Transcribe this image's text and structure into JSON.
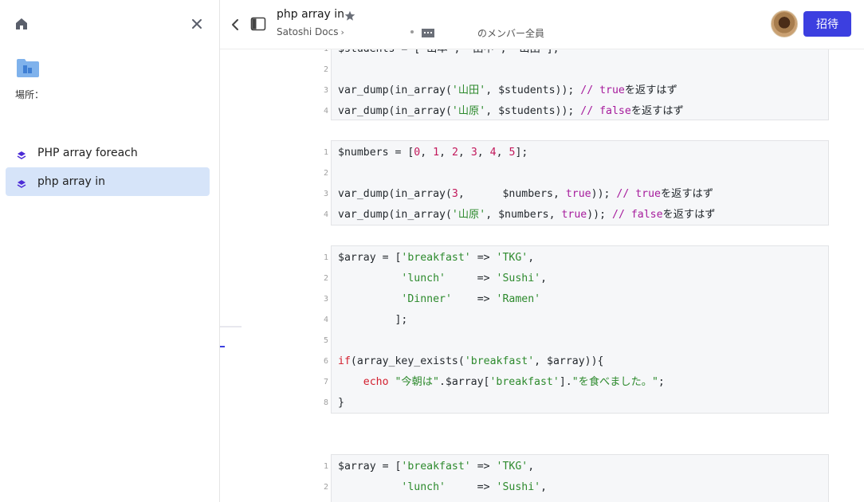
{
  "sidebar": {
    "location_label": "場所：",
    "items": [
      {
        "label": "PHP array foreach",
        "active": false
      },
      {
        "label": "php array in",
        "active": true
      }
    ]
  },
  "header": {
    "title": "php array in",
    "breadcrumb_workspace": "Satoshi Docs",
    "breadcrumb_chevron": "›",
    "members_label": "のメンバー全員",
    "invite_label": "招待"
  },
  "colors": {
    "accent": "#3c3fe0",
    "active_item_bg": "#d6e4f9",
    "string": "#2d8a2d",
    "number": "#c2185b",
    "keyword": "#d3202f"
  },
  "code_blocks": [
    {
      "lines": [
        {
          "n": "1",
          "tokens": [
            [
              "plain",
              "$students = ['山本', '田中', '山田'];"
            ]
          ]
        },
        {
          "n": "2",
          "tokens": []
        },
        {
          "n": "3",
          "tokens": [
            [
              "plain",
              "var_dump(in_array("
            ],
            [
              "str",
              "'山田'"
            ],
            [
              "plain",
              ", $students)); "
            ],
            [
              "com",
              "// "
            ],
            [
              "bool",
              "true"
            ],
            [
              "plain",
              "を返すはず"
            ]
          ]
        },
        {
          "n": "4",
          "tokens": [
            [
              "plain",
              "var_dump(in_array("
            ],
            [
              "str",
              "'山原'"
            ],
            [
              "plain",
              ", $students)); "
            ],
            [
              "com",
              "// "
            ],
            [
              "bool",
              "false"
            ],
            [
              "plain",
              "を返すはず"
            ]
          ]
        }
      ]
    },
    {
      "lines": [
        {
          "n": "1",
          "tokens": [
            [
              "plain",
              "$numbers = ["
            ],
            [
              "num",
              "0"
            ],
            [
              "plain",
              ", "
            ],
            [
              "num",
              "1"
            ],
            [
              "plain",
              ", "
            ],
            [
              "num",
              "2"
            ],
            [
              "plain",
              ", "
            ],
            [
              "num",
              "3"
            ],
            [
              "plain",
              ", "
            ],
            [
              "num",
              "4"
            ],
            [
              "plain",
              ", "
            ],
            [
              "num",
              "5"
            ],
            [
              "plain",
              "];"
            ]
          ]
        },
        {
          "n": "2",
          "tokens": []
        },
        {
          "n": "3",
          "tokens": [
            [
              "plain",
              "var_dump(in_array("
            ],
            [
              "num",
              "3"
            ],
            [
              "plain",
              ",      $numbers, "
            ],
            [
              "bool",
              "true"
            ],
            [
              "plain",
              ")); "
            ],
            [
              "com",
              "// "
            ],
            [
              "bool",
              "true"
            ],
            [
              "plain",
              "を返すはず"
            ]
          ]
        },
        {
          "n": "4",
          "tokens": [
            [
              "plain",
              "var_dump(in_array("
            ],
            [
              "str",
              "'山原'"
            ],
            [
              "plain",
              ", $numbers, "
            ],
            [
              "bool",
              "true"
            ],
            [
              "plain",
              ")); "
            ],
            [
              "com",
              "// "
            ],
            [
              "bool",
              "false"
            ],
            [
              "plain",
              "を返すはず"
            ]
          ]
        }
      ]
    },
    {
      "lines": [
        {
          "n": "1",
          "tokens": [
            [
              "plain",
              "$array = ["
            ],
            [
              "str",
              "'breakfast'"
            ],
            [
              "plain",
              " => "
            ],
            [
              "str",
              "'TKG'"
            ],
            [
              "plain",
              ","
            ]
          ]
        },
        {
          "n": "2",
          "tokens": [
            [
              "plain",
              "          "
            ],
            [
              "str",
              "'lunch'"
            ],
            [
              "plain",
              "     => "
            ],
            [
              "str",
              "'Sushi'"
            ],
            [
              "plain",
              ","
            ]
          ]
        },
        {
          "n": "3",
          "tokens": [
            [
              "plain",
              "          "
            ],
            [
              "str",
              "'Dinner'"
            ],
            [
              "plain",
              "    => "
            ],
            [
              "str",
              "'Ramen'"
            ]
          ]
        },
        {
          "n": "4",
          "tokens": [
            [
              "plain",
              "         ];"
            ]
          ]
        },
        {
          "n": "5",
          "tokens": []
        },
        {
          "n": "6",
          "tokens": [
            [
              "kw",
              "if"
            ],
            [
              "plain",
              "(array_key_exists("
            ],
            [
              "str",
              "'breakfast'"
            ],
            [
              "plain",
              ", $array)){"
            ]
          ]
        },
        {
          "n": "7",
          "tokens": [
            [
              "plain",
              "    "
            ],
            [
              "kw",
              "echo"
            ],
            [
              "plain",
              " "
            ],
            [
              "str",
              "\"今朝は\""
            ],
            [
              "plain",
              ".$array["
            ],
            [
              "str",
              "'breakfast'"
            ],
            [
              "plain",
              "]."
            ],
            [
              "str",
              "\"を食べました。\""
            ],
            [
              "plain",
              ";"
            ]
          ]
        },
        {
          "n": "8",
          "tokens": [
            [
              "plain",
              "}"
            ]
          ]
        }
      ]
    },
    {
      "lines": [
        {
          "n": "1",
          "tokens": [
            [
              "plain",
              "$array = ["
            ],
            [
              "str",
              "'breakfast'"
            ],
            [
              "plain",
              " => "
            ],
            [
              "str",
              "'TKG'"
            ],
            [
              "plain",
              ","
            ]
          ]
        },
        {
          "n": "2",
          "tokens": [
            [
              "plain",
              "          "
            ],
            [
              "str",
              "'lunch'"
            ],
            [
              "plain",
              "     => "
            ],
            [
              "str",
              "'Sushi'"
            ],
            [
              "plain",
              ","
            ]
          ]
        }
      ]
    }
  ]
}
